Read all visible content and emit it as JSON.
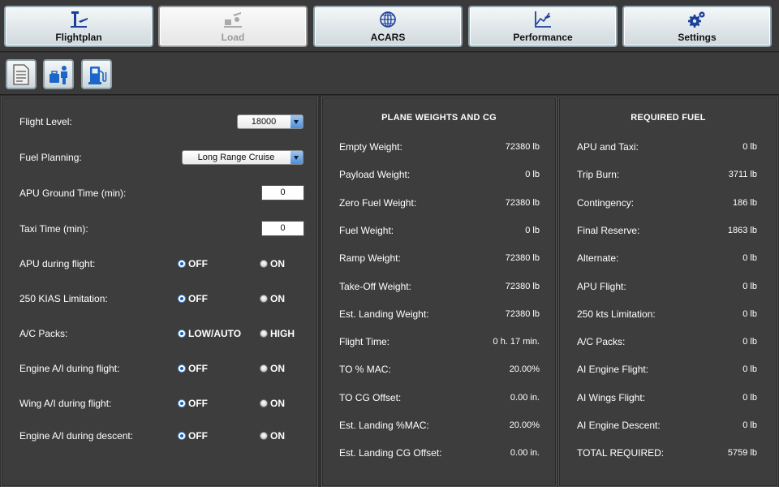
{
  "tabs": [
    {
      "label": "Flightplan",
      "icon": "flightplan-icon",
      "active": false
    },
    {
      "label": "Load",
      "icon": "load-icon",
      "active": true
    },
    {
      "label": "ACARS",
      "icon": "acars-globe-icon",
      "active": false
    },
    {
      "label": "Performance",
      "icon": "performance-icon",
      "active": false
    },
    {
      "label": "Settings",
      "icon": "settings-gears-icon",
      "active": false
    }
  ],
  "subtoolbar": [
    {
      "icon": "document-icon"
    },
    {
      "icon": "passenger-baggage-icon"
    },
    {
      "icon": "fuel-pump-icon"
    }
  ],
  "left": {
    "flight_level": {
      "label": "Flight Level:",
      "value": "18000"
    },
    "fuel_planning": {
      "label": "Fuel Planning:",
      "value": "Long Range Cruise"
    },
    "apu_ground_time": {
      "label": "APU Ground Time (min):",
      "value": "0"
    },
    "taxi_time": {
      "label": "Taxi Time (min):",
      "value": "0"
    },
    "radios": [
      {
        "label": "APU during flight:",
        "opt1": "OFF",
        "opt2": "ON",
        "selected": 1
      },
      {
        "label": "250 KIAS Limitation:",
        "opt1": "OFF",
        "opt2": "ON",
        "selected": 1
      },
      {
        "label": "A/C Packs:",
        "opt1": "LOW/AUTO",
        "opt2": "HIGH",
        "selected": 1
      },
      {
        "label": "Engine A/I during flight:",
        "opt1": "OFF",
        "opt2": "ON",
        "selected": 1
      },
      {
        "label": "Wing A/I during flight:",
        "opt1": "OFF",
        "opt2": "ON",
        "selected": 1
      },
      {
        "label": "Engine A/I during descent:",
        "opt1": "OFF",
        "opt2": "ON",
        "selected": 1
      }
    ]
  },
  "weights": {
    "title": "PLANE WEIGHTS AND CG",
    "rows": [
      {
        "label": "Empty Weight:",
        "value": "72380 lb"
      },
      {
        "label": "Payload Weight:",
        "value": "0 lb"
      },
      {
        "label": "Zero Fuel Weight:",
        "value": "72380 lb"
      },
      {
        "label": "Fuel Weight:",
        "value": "0 lb"
      },
      {
        "label": "Ramp Weight:",
        "value": "72380 lb"
      },
      {
        "label": "Take-Off Weight:",
        "value": "72380 lb"
      },
      {
        "label": "Est. Landing Weight:",
        "value": "72380 lb"
      },
      {
        "label": "Flight Time:",
        "value": "0 h. 17 min."
      },
      {
        "label": "TO % MAC:",
        "value": "20.00%"
      },
      {
        "label": "TO CG Offset:",
        "value": "0.00 in."
      },
      {
        "label": "Est. Landing %MAC:",
        "value": "20.00%"
      },
      {
        "label": "Est. Landing CG Offset:",
        "value": "0.00 in."
      }
    ]
  },
  "fuel": {
    "title": "REQUIRED FUEL",
    "rows": [
      {
        "label": "APU and Taxi:",
        "value": "0 lb"
      },
      {
        "label": "Trip Burn:",
        "value": "3711 lb"
      },
      {
        "label": "Contingency:",
        "value": "186 lb"
      },
      {
        "label": "Final Reserve:",
        "value": "1863 lb"
      },
      {
        "label": "Alternate:",
        "value": "0 lb"
      },
      {
        "label": "APU Flight:",
        "value": "0 lb"
      },
      {
        "label": "250 kts Limitation:",
        "value": "0 lb"
      },
      {
        "label": "A/C Packs:",
        "value": "0 lb"
      },
      {
        "label": "AI Engine Flight:",
        "value": "0 lb"
      },
      {
        "label": "AI Wings Flight:",
        "value": "0 lb"
      },
      {
        "label": "AI Engine Descent:",
        "value": "0 lb"
      },
      {
        "label": "TOTAL REQUIRED:",
        "value": "5759 lb"
      }
    ]
  },
  "colors": {
    "background": "#2f2f2f",
    "panel": "#3d3d3d",
    "accent": "#4d8fd9",
    "icon_blue": "#1c3f9a"
  }
}
